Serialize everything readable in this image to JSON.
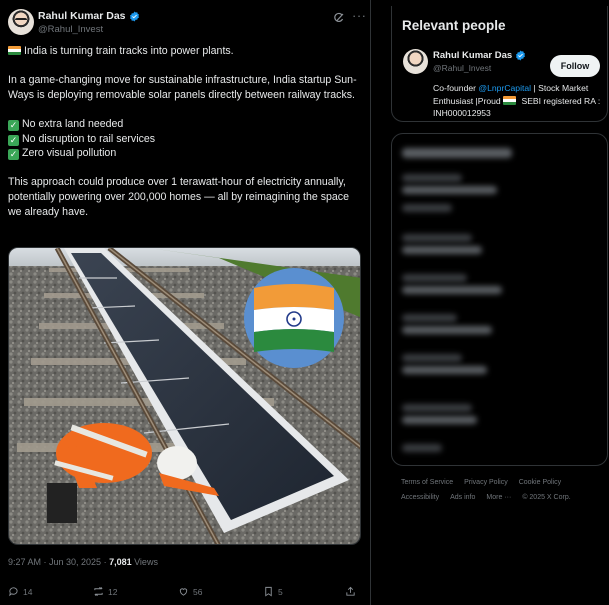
{
  "post": {
    "author_name": "Rahul Kumar Das",
    "author_handle": "@Rahul_Invest",
    "intro": "India  is turning train tracks into power plants.",
    "para1": "In a game-changing move for sustainable infrastructure, India startup Sun-Ways is deploying removable solar panels directly between railway tracks.",
    "bullets": [
      "No extra land needed",
      "No disruption to rail services",
      "Zero visual pollution"
    ],
    "para2": "This approach could produce over 1 terawatt-hour of electricity annually, potentially powering over 200,000 homes — all by reimagining the space we already have.",
    "timestamp": "9:27 AM · Jun 30, 2025 · ",
    "views_count": "7,081",
    "views_label": " Views",
    "replies": "14",
    "reposts": "12",
    "likes": "56",
    "bookmarks": "5"
  },
  "sidebar": {
    "relevant_title": "Relevant people",
    "person_name": "Rahul Kumar Das",
    "person_handle": "@Rahul_Invest",
    "follow_label": "Follow",
    "bio_prefix": "Co-founder ",
    "bio_mention": "@LnprCapital",
    "bio_rest": " | Stock Market Enthusiast |Proud ",
    "bio_tail": " SEBI registered RA : INH000012953"
  },
  "footer": {
    "terms": "Terms of Service",
    "privacy": "Privacy Policy",
    "cookie": "Cookie Policy",
    "accessibility": "Accessibility",
    "ads": "Ads info",
    "more": "More ···",
    "copyright": "© 2025 X Corp."
  },
  "colors": {
    "accent": "#1d9bf0",
    "background": "#000000",
    "border": "#2f3336",
    "muted_text": "#71767b"
  }
}
